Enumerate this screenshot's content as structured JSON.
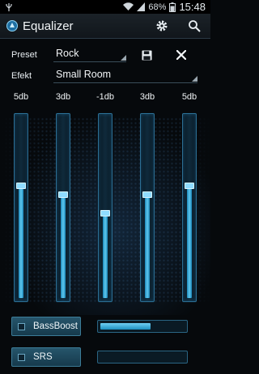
{
  "status_bar": {
    "battery_percent": "68%",
    "time": "15:48",
    "icons": [
      "usb-icon",
      "wifi-icon",
      "signal-icon",
      "battery-icon"
    ]
  },
  "app": {
    "title": "Equalizer",
    "actions": [
      "settings-gear-icon",
      "search-icon"
    ]
  },
  "preset": {
    "label": "Preset",
    "value": "Rock"
  },
  "effect": {
    "label": "Efekt",
    "value": "Small Room"
  },
  "bands": [
    {
      "label": "5db",
      "level": 0.62
    },
    {
      "label": "3db",
      "level": 0.57
    },
    {
      "label": "-1db",
      "level": 0.47
    },
    {
      "label": "3db",
      "level": 0.57
    },
    {
      "label": "5db",
      "level": 0.62
    }
  ],
  "toggles": [
    {
      "label": "BassBoost",
      "level": 0.6
    },
    {
      "label": "SRS",
      "level": 0
    }
  ],
  "colors": {
    "accent": "#5ec8ef",
    "background": "#06090c"
  }
}
